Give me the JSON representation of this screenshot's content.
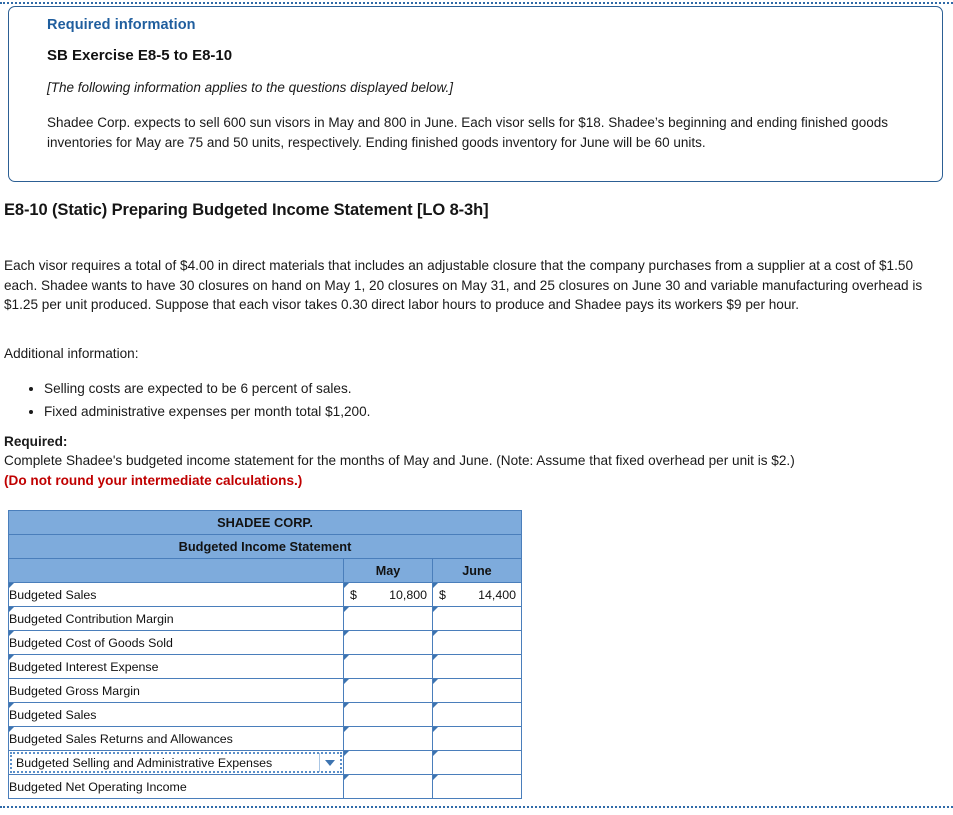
{
  "required_box": {
    "heading": "Required information",
    "subheading": "SB Exercise E8-5 to E8-10",
    "italic_note": "[The following information applies to the questions displayed below.]",
    "body": "Shadee Corp. expects to sell 600 sun visors in May and 800 in June. Each visor sells for $18. Shadee’s beginning and ending finished goods inventories for May are 75 and 50 units, respectively. Ending finished goods inventory for June will be 60 units."
  },
  "exercise": {
    "title": "E8-10 (Static) Preparing Budgeted Income Statement [LO 8-3h]",
    "paragraph": "Each visor requires a total of $4.00 in direct materials that includes an adjustable closure that the company purchases from a supplier at a cost of $1.50 each. Shadee wants to have 30 closures on hand on May 1, 20 closures on May 31, and 25 closures on June 30 and variable manufacturing overhead is $1.25 per unit produced. Suppose that each visor takes 0.30 direct labor hours to produce and Shadee pays its workers $9 per hour.",
    "additional_label": "Additional information:",
    "bullets": [
      "Selling costs are expected to be 6 percent of sales.",
      "Fixed administrative expenses per month total $1,200."
    ],
    "required_label": "Required:",
    "required_text": "Complete Shadee's budgeted income statement for the months of May and June. (Note: Assume that fixed overhead per unit is $2.)",
    "required_red": "(Do not round your intermediate calculations.)"
  },
  "sheet": {
    "company": "SHADEE CORP.",
    "statement_title": "Budgeted Income Statement",
    "col_blank": "",
    "col_may": "May",
    "col_june": "June",
    "rows": [
      {
        "label": "Budgeted Sales",
        "may_currency": "$",
        "may_value": "10,800",
        "june_currency": "$",
        "june_value": "14,400"
      },
      {
        "label": "Budgeted Contribution Margin",
        "may_currency": "",
        "may_value": "",
        "june_currency": "",
        "june_value": ""
      },
      {
        "label": "Budgeted Cost of Goods Sold",
        "may_currency": "",
        "may_value": "",
        "june_currency": "",
        "june_value": ""
      },
      {
        "label": "Budgeted Interest Expense",
        "may_currency": "",
        "may_value": "",
        "june_currency": "",
        "june_value": ""
      },
      {
        "label": "Budgeted Gross Margin",
        "may_currency": "",
        "may_value": "",
        "june_currency": "",
        "june_value": ""
      },
      {
        "label": "Budgeted Sales",
        "may_currency": "",
        "may_value": "",
        "june_currency": "",
        "june_value": ""
      },
      {
        "label": "Budgeted Sales Returns and Allowances",
        "may_currency": "",
        "may_value": "",
        "june_currency": "",
        "june_value": ""
      },
      {
        "label": "Budgeted Selling and Administrative Expenses",
        "may_currency": "",
        "may_value": "",
        "june_currency": "",
        "june_value": ""
      },
      {
        "label": "Budgeted Net Operating Income",
        "may_currency": "",
        "may_value": "",
        "june_currency": "",
        "june_value": ""
      }
    ]
  },
  "colors": {
    "header_blue": "#7eabdc",
    "grid_blue": "#4a7ebb",
    "link_blue": "#1f5e9e",
    "alert_red": "#c00000"
  }
}
